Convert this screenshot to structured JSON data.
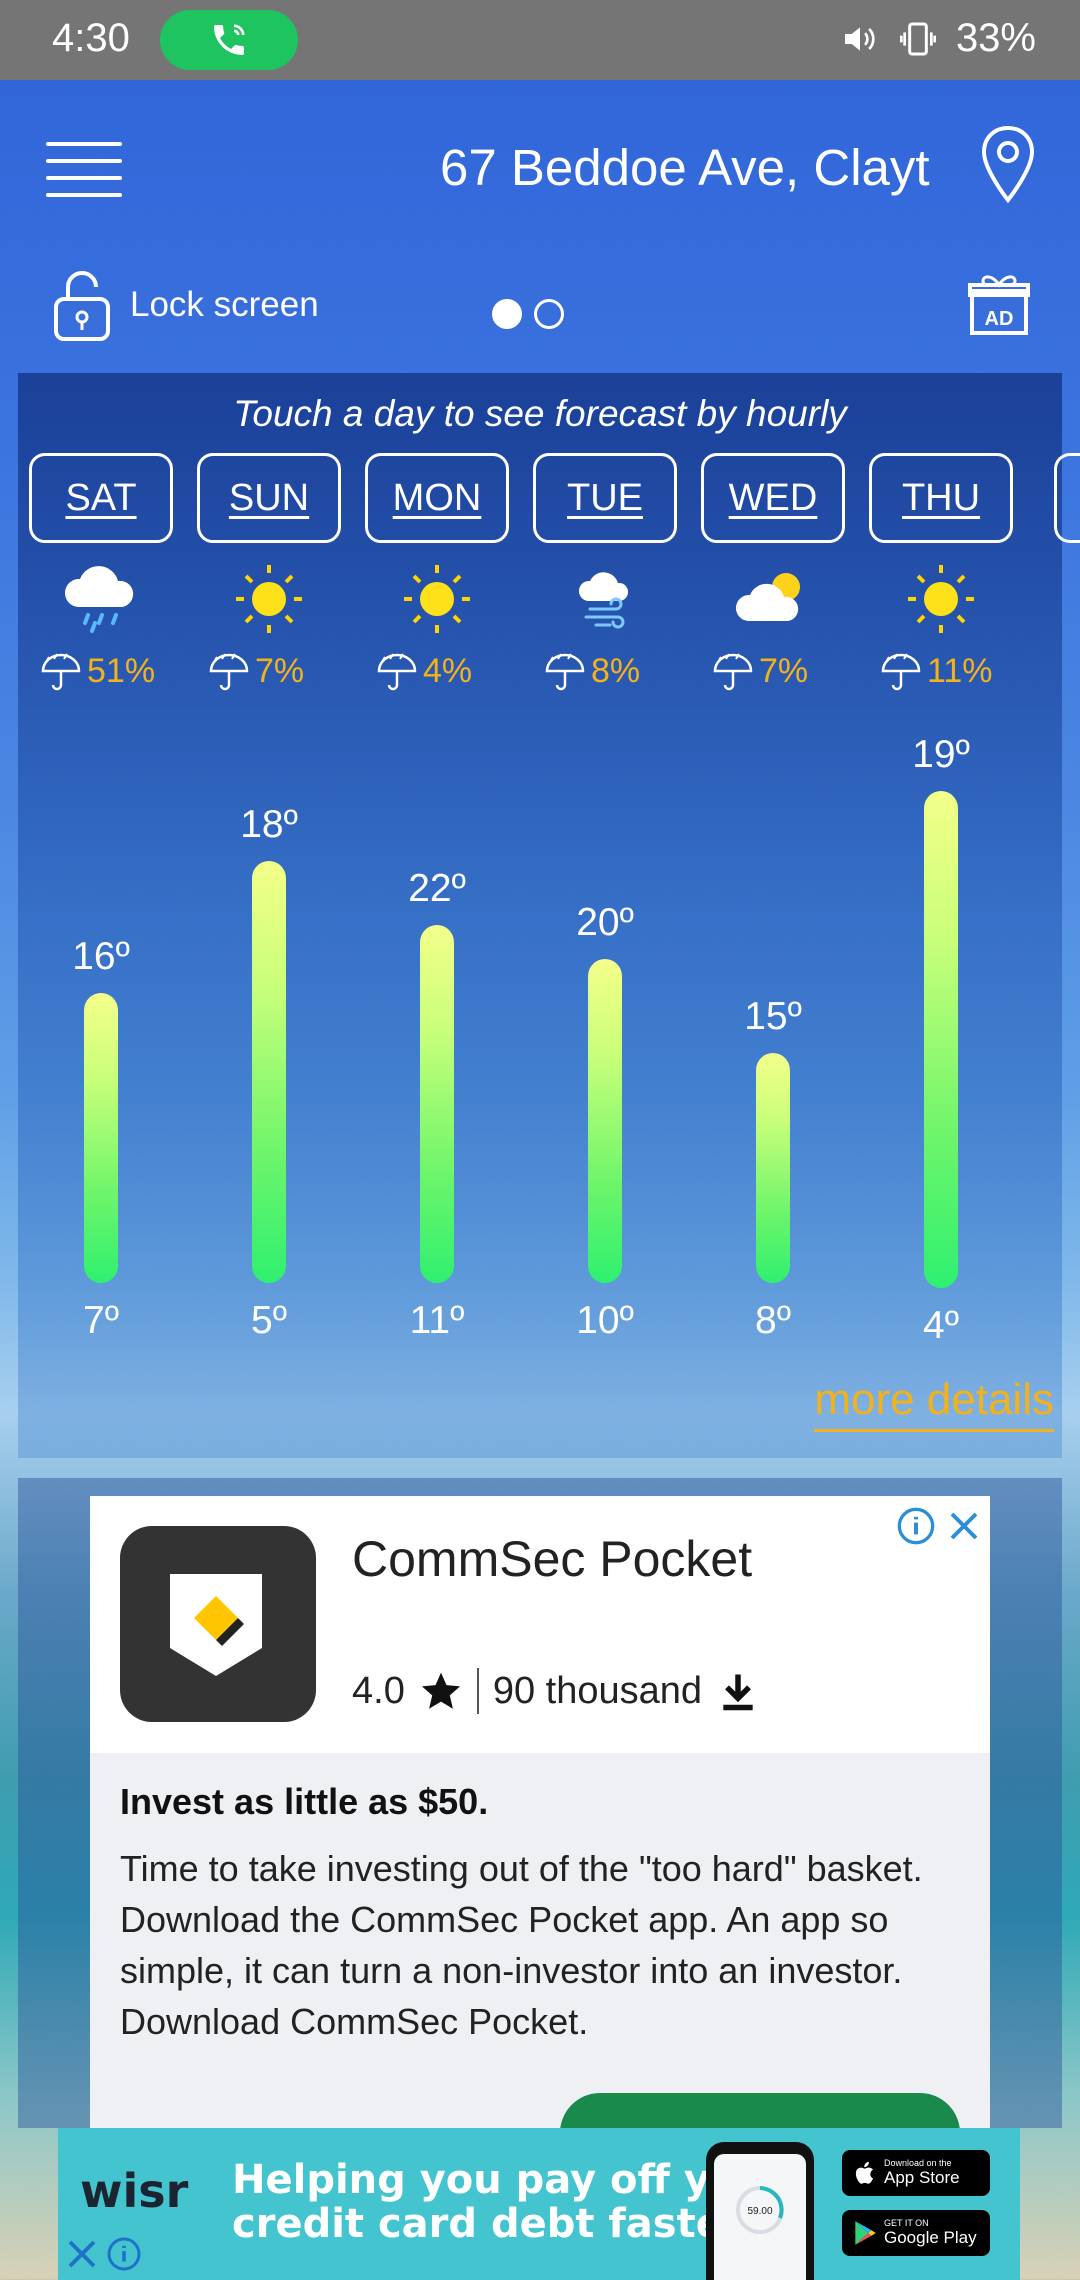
{
  "status_bar": {
    "time": "4:30",
    "battery": "33%",
    "call_active_color": "#1ec45f"
  },
  "header": {
    "address": "67 Beddoe Ave, Clayt",
    "lock_label": "Lock screen",
    "page_dots": 2,
    "active_dot": 0
  },
  "forecast": {
    "hint": "Touch a day to see forecast by hourly",
    "more_details": "more details",
    "days": [
      {
        "day": "SAT",
        "icon": "rain-cloud-icon",
        "precip": "51%",
        "high": "16º",
        "low": "7º",
        "high_value": 16,
        "low_value": 7
      },
      {
        "day": "SUN",
        "icon": "sun-icon",
        "precip": "7%",
        "high": "18º",
        "low": "5º",
        "high_value": 18,
        "low_value": 5
      },
      {
        "day": "MON",
        "icon": "sun-icon",
        "precip": "4%",
        "high": "22º",
        "low": "11º",
        "high_value": 22,
        "low_value": 11
      },
      {
        "day": "TUE",
        "icon": "windy-cloud-icon",
        "precip": "8%",
        "high": "20º",
        "low": "10º",
        "high_value": 20,
        "low_value": 10
      },
      {
        "day": "WED",
        "icon": "partly-cloudy-icon",
        "precip": "7%",
        "high": "15º",
        "low": "8º",
        "high_value": 15,
        "low_value": 8
      },
      {
        "day": "THU",
        "icon": "sun-icon",
        "precip": "11%",
        "high": "19º",
        "low": "4º",
        "high_value": 19,
        "low_value": 4
      }
    ]
  },
  "ad": {
    "app_name": "CommSec Pocket",
    "rating": "4.0",
    "downloads": "90 thousand",
    "headline": "Invest as little as $50.",
    "body": "Time to take investing out of the \"too hard\" basket. Download the CommSec Pocket app. An app so simple, it can turn a non-investor into an investor. Download CommSec Pocket."
  },
  "banner": {
    "brand": "wisr",
    "text_line1": "Helping you pay off your",
    "text_line2": "credit card debt faster.",
    "app_store_small": "Download on the",
    "app_store": "App Store",
    "google_play_small": "GET IT ON",
    "google_play": "Google Play",
    "phone_figure": "59.00"
  }
}
